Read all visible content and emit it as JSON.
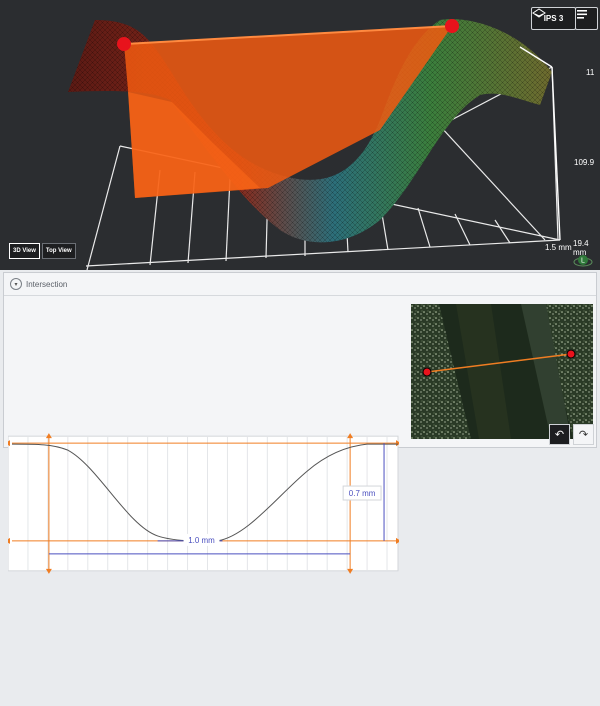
{
  "viewport": {
    "ips_label": "IPS 3",
    "axis_top": "11",
    "axis_mid": "109.9",
    "axis_bottom_left": "1.5 mm",
    "axis_bottom_right": "19.4 mm",
    "view_3d": "3D View",
    "view_top": "Top View",
    "compass_label": "L"
  },
  "panel": {
    "title": "Intersection",
    "width_measure": "1.0 mm",
    "depth_measure": "0.7 mm"
  },
  "colors": {
    "accent": "#f07d22",
    "measure": "#4a4fbf",
    "dot": "#e8131c"
  }
}
